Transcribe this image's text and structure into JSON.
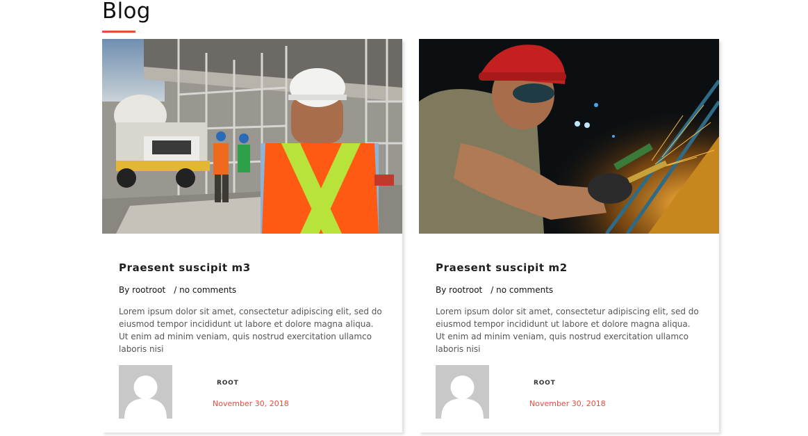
{
  "section": {
    "title": "Blog"
  },
  "colors": {
    "accent": "#e84c3d",
    "text_dark": "#111111",
    "text_body": "#555555",
    "avatar_bg": "#c8c8c8"
  },
  "posts": [
    {
      "title": "Praesent suscipit m3",
      "author_prefix": "By rootroot",
      "comments": "/ no comments",
      "excerpt": "Lorem ipsum dolor sit amet, consectetur adipiscing elit, sed do eiusmod tempor incididunt ut labore et dolore magna aliqua. Ut enim ad minim veniam, quis nostrud exercitation ullamco laboris nisi",
      "author_name": "ROOT",
      "date": "November 30, 2018",
      "image_subject": "construction-workers-photo",
      "avatar_icon": "default-user-avatar-icon"
    },
    {
      "title": "Praesent suscipit m2",
      "author_prefix": "By rootroot",
      "comments": "/ no comments",
      "excerpt": "Lorem ipsum dolor sit amet, consectetur adipiscing elit, sed do eiusmod tempor incididunt ut labore et dolore magna aliqua. Ut enim ad minim veniam, quis nostrud exercitation ullamco laboris nisi",
      "author_name": "ROOT",
      "date": "November 30, 2018",
      "image_subject": "welder-worker-photo",
      "avatar_icon": "default-user-avatar-icon"
    }
  ]
}
